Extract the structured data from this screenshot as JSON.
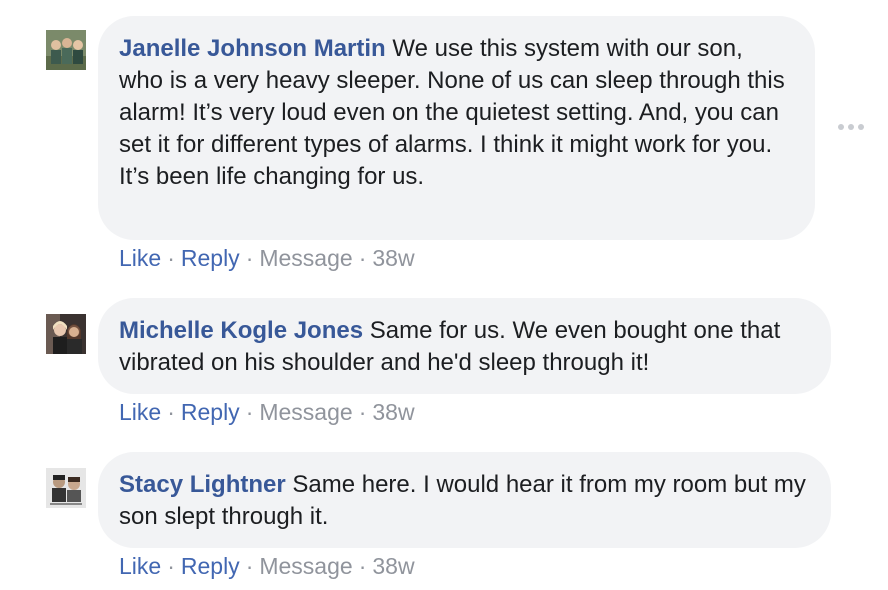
{
  "comments": [
    {
      "author": "Janelle Johnson Martin",
      "text": "We use this system with our son, who is a very heavy sleeper. None of us can sleep through this alarm! It’s very loud even on the quietest setting. And, you can set it for different types of alarms. I think it might work for you. It’s been life changing for us.",
      "actions": {
        "like": "Like",
        "reply": "Reply",
        "message": "Message",
        "time": "38w",
        "separator": "·"
      }
    },
    {
      "author": "Michelle Kogle Jones",
      "text": "Same for us. We even bought one that vibrated on his shoulder and he'd sleep through it!",
      "actions": {
        "like": "Like",
        "reply": "Reply",
        "message": "Message",
        "time": "38w",
        "separator": "·"
      }
    },
    {
      "author": "Stacy Lightner",
      "text": "Same here. I would hear it from my room but my son slept through it.",
      "actions": {
        "like": "Like",
        "reply": "Reply",
        "message": "Message",
        "time": "38w",
        "separator": "·"
      }
    }
  ],
  "icons": {
    "more_options": "more-options-icon",
    "avatar": "avatar"
  },
  "colors": {
    "author_link": "#385898",
    "action_link": "#4267b2",
    "muted": "#90949c",
    "bubble_bg": "#f2f3f5",
    "text": "#1c1e21"
  }
}
